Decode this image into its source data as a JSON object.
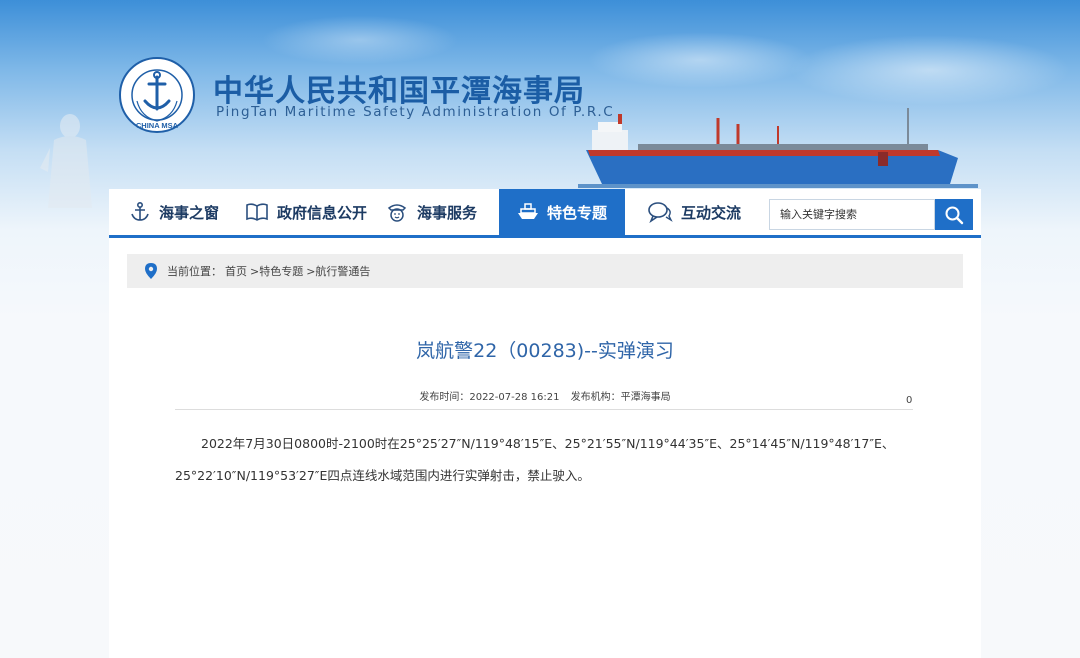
{
  "header": {
    "logo_text": "中国海事局 CHINA MSA",
    "title": "中华人民共和国平潭海事局",
    "subtitle": "PingTan Maritime Safety Administration Of P.R.C"
  },
  "nav": {
    "items": [
      {
        "label": "海事之窗",
        "icon": "anchor-icon"
      },
      {
        "label": "政府信息公开",
        "icon": "book-icon"
      },
      {
        "label": "海事服务",
        "icon": "officer-icon"
      },
      {
        "label": "特色专题",
        "icon": "ship-icon",
        "active": true
      },
      {
        "label": "互动交流",
        "icon": "chat-icon"
      }
    ],
    "search_placeholder": "输入关键字搜索"
  },
  "breadcrumb": {
    "prefix": "当前位置：",
    "items": [
      "首页",
      ">特色专题",
      ">航行警通告"
    ]
  },
  "article": {
    "title": "岚航警22（00283)--实弹演习",
    "publish_time_label": "发布时间：2022-07-28 16:21",
    "publisher_label": "发布机构：平潭海事局",
    "view_count": "0",
    "body": "2022年7月30日0800时-2100时在25°25′27″N/119°48′15″E、25°21′55″N/119°44′35″E、25°14′45″N/119°48′17″E、25°22′10″N/119°53′27″E四点连线水域范围内进行实弹射击，禁止驶入。"
  },
  "colors": {
    "nav_active": "#1f6fc8",
    "title_blue": "#2f65a8",
    "site_title": "#1b5da5"
  }
}
